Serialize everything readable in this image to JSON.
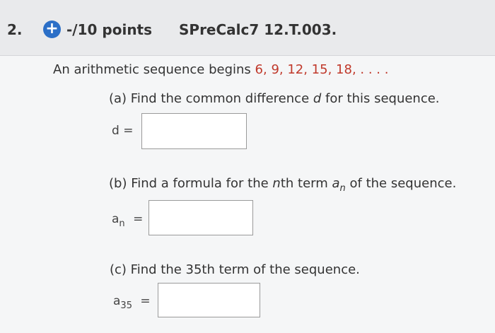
{
  "header": {
    "question_number": "2.",
    "points": "-/10 points",
    "assignment_id": "SPreCalc7 12.T.003."
  },
  "intro": {
    "prefix": "An arithmetic sequence begins",
    "sequence": "6, 9, 12, 15, 18, . . . ."
  },
  "parts": {
    "a": {
      "label": "(a) Find the common difference ",
      "var": "d",
      "suffix": " for this sequence.",
      "answer_label": "d =",
      "answer_value": ""
    },
    "b": {
      "label_before": "(b) Find a formula for the ",
      "var_n": "n",
      "label_mid": "th term ",
      "var_a": "a",
      "sub_n": "n",
      "label_after": " of the sequence.",
      "answer_var": "a",
      "answer_sub": "n",
      "answer_eq": "=",
      "answer_value": ""
    },
    "c": {
      "label": "(c) Find the 35th term of the sequence.",
      "answer_var": "a",
      "answer_sub": "35",
      "answer_eq": "=",
      "answer_value": ""
    }
  },
  "colors": {
    "accent": "#2b6fc7",
    "sequence": "#c0392b"
  }
}
